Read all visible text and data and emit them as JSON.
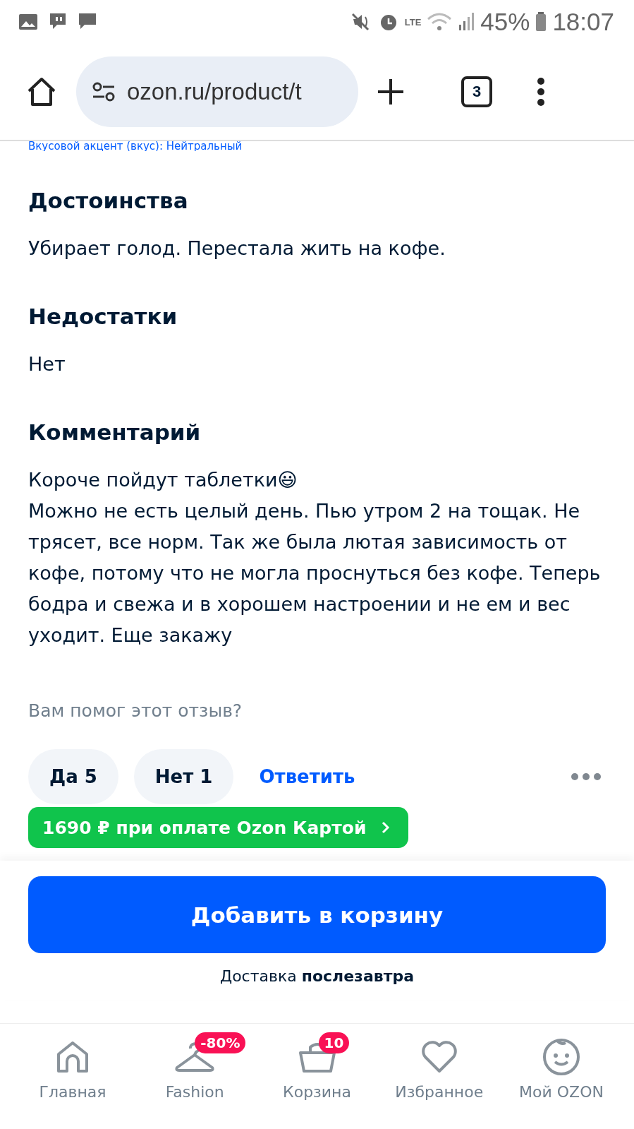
{
  "status_bar": {
    "battery": "45%",
    "time": "18:07",
    "lte": "LTE"
  },
  "browser": {
    "url": "ozon.ru/product/t",
    "tab_count": "3"
  },
  "cut_line": "Вкусовой акцент (вкус): Нейтральный",
  "sections": [
    {
      "title": "Достоинства",
      "text": "Убирает голод. Перестала жить на кофе."
    },
    {
      "title": "Недостатки",
      "text": "Нет"
    },
    {
      "title": "Комментарий",
      "text": "Короче пойдут таблетки😃\nМожно не есть целый день. Пью утром 2 на тощак. Не трясет, все норм. Так же была лютая зависимость от кофе, потому что не могла проснуться без кофе. Теперь бодра и свежа и в хорошем настроении и не ем и вес уходит. Еще закажу"
    }
  ],
  "helpful": {
    "question": "Вам помог этот отзыв?",
    "yes": "Да 5",
    "no": "Нет 1",
    "reply": "Ответить"
  },
  "promo": "1690 ₽ при оплате Ozon Картой",
  "cart_button": "Добавить в корзину",
  "delivery": "Доставка **послезавтра**",
  "nav": [
    {
      "label": "Главная",
      "kind": "home"
    },
    {
      "label": "Fashion",
      "kind": "hanger",
      "badge": "-80%"
    },
    {
      "label": "Корзина",
      "kind": "basket",
      "badge": "10"
    },
    {
      "label": "Избранное",
      "kind": "heart"
    },
    {
      "label": "Мой OZON",
      "kind": "face"
    }
  ]
}
